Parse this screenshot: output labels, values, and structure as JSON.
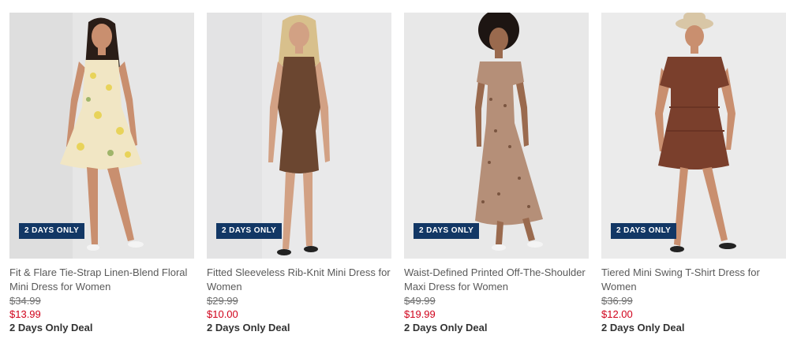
{
  "products": [
    {
      "badge": "2 DAYS ONLY",
      "title": "Fit & Flare Tie-Strap Linen-Blend Floral Mini Dress for Women",
      "original_price": "$34.99",
      "sale_price": "$13.99",
      "deal_label": "2 Days Only Deal",
      "dress_color": "#f1e6c4",
      "background": "#e8e8e8"
    },
    {
      "badge": "2 DAYS ONLY",
      "title": "Fitted Sleeveless Rib-Knit Mini Dress for Women",
      "original_price": "$29.99",
      "sale_price": "$10.00",
      "deal_label": "2 Days Only Deal",
      "dress_color": "#6b4630",
      "background": "#e9e9ea"
    },
    {
      "badge": "2 DAYS ONLY",
      "title": "Waist-Defined Printed Off-The-Shoulder Maxi Dress for Women",
      "original_price": "$49.99",
      "sale_price": "$19.99",
      "deal_label": "2 Days Only Deal",
      "dress_color": "#b58f78",
      "background": "#e8e8e8"
    },
    {
      "badge": "2 DAYS ONLY",
      "title": "Tiered Mini Swing T-Shirt Dress for Women",
      "original_price": "$36.99",
      "sale_price": "$12.00",
      "deal_label": "2 Days Only Deal",
      "dress_color": "#7a3f2c",
      "background": "#ebebeb"
    }
  ],
  "colors": {
    "badge_bg": "#123765",
    "sale_price": "#d0021b",
    "skin": "#c98f6f"
  }
}
